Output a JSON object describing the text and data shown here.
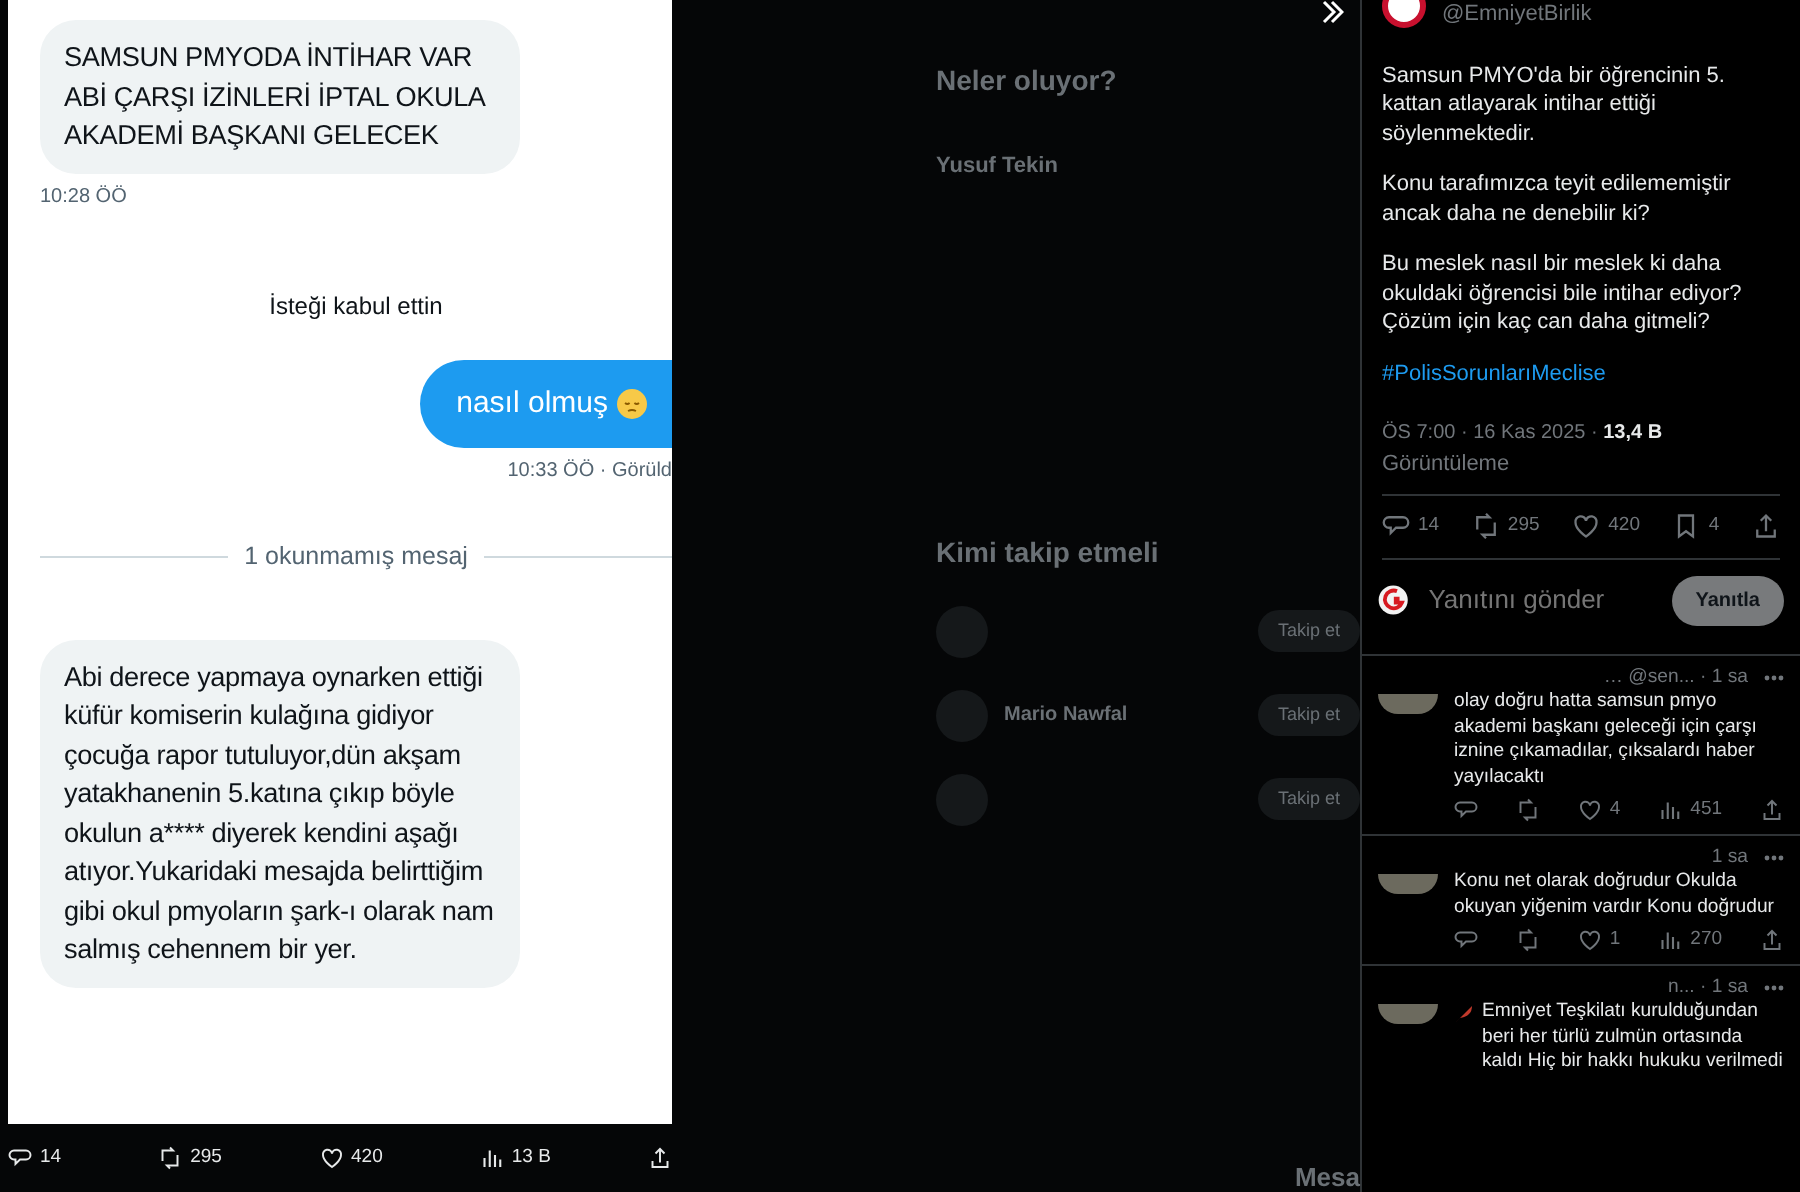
{
  "media": {
    "messages": [
      {
        "kind": "received",
        "text": "SAMSUN PMYODA İNTİHAR VAR ABİ ÇARŞI İZİNLERİ İPTAL OKULA AKADEMİ BAŞKANI GELECEK",
        "time": "10:28 ÖÖ"
      },
      {
        "kind": "notice",
        "text": "İsteği kabul ettin"
      },
      {
        "kind": "sent",
        "text": "nasıl olmuş",
        "time": "10:33 ÖÖ · Görüld"
      },
      {
        "kind": "divider",
        "text": "1 okunmamış mesaj"
      },
      {
        "kind": "received",
        "text": "Abi derece yapmaya oynarken ettiği küfür komiserin kulağına gidiyor çocuğa rapor tutuluyor,dün akşam yatakhanenin 5.katına çıkıp böyle okulun a**** diyerek kendini aşağı atıyor.Yukaridaki mesajda belirttiğim gibi okul pmyoların şark-ı olarak nam salmış cehennem bir yer."
      }
    ]
  },
  "media_actions": [
    {
      "kind": "reply",
      "count": "14"
    },
    {
      "kind": "repost",
      "count": "295"
    },
    {
      "kind": "like",
      "count": "420"
    },
    {
      "kind": "views",
      "count": "13 B"
    }
  ],
  "background": {
    "trends_title": "Neler oluyor?",
    "trends": [
      "Yusuf Tekin"
    ],
    "follow_title": "Kimi takip etmeli",
    "accounts": [
      {
        "button": "Takip et"
      },
      {
        "name": "Mario Nawfal",
        "button": "Takip et"
      },
      {
        "button": "Takip et"
      }
    ],
    "drawer": "Mesa"
  },
  "tweet": {
    "handle": "@EmniyetBirlik",
    "paragraphs": [
      "Samsun PMYO'da bir öğrencinin 5. kattan atlayarak intihar ettiği söylenmektedir.",
      "Konu tarafımızca teyit edilememiştir ancak daha ne denebilir ki?",
      "Bu meslek nasıl bir meslek ki daha okuldaki öğrencisi bile intihar ediyor? Çözüm için kaç can daha gitmeli?"
    ],
    "hashtag": "#PolisSorunlarıMeclise",
    "meta": "ÖS 7:00 · 16 Kas 2025 · **13,4 B**",
    "views_label": "Görüntüleme",
    "actions": [
      {
        "kind": "reply",
        "count": "14"
      },
      {
        "kind": "repost",
        "count": "295"
      },
      {
        "kind": "like",
        "count": "420"
      },
      {
        "kind": "bookmark",
        "count": "4"
      },
      {
        "kind": "share"
      }
    ]
  },
  "reply_box": {
    "placeholder": "Yanıtını gönder",
    "button": "Yanıtla",
    "disabled": true
  },
  "replies": [
    {
      "kind": "plain",
      "header": "… @sen... · 1 sa",
      "text": "olay doğru hatta samsun pmyo akademi başkanı geleceği için çarşı iznine çıkamadılar, çıksalardı haber yayılacaktı",
      "actions": [
        {
          "kind": "reply"
        },
        {
          "kind": "repost"
        },
        {
          "kind": "like",
          "count": "4"
        },
        {
          "kind": "views",
          "count": "451"
        },
        {
          "kind": "share"
        }
      ]
    },
    {
      "kind": "plain",
      "header": "1 sa",
      "text": "Konu net olarak doğrudur Okulda okuyan yiğenim vardır Konu doğrudur",
      "actions": [
        {
          "kind": "reply"
        },
        {
          "kind": "repost"
        },
        {
          "kind": "like",
          "count": "1"
        },
        {
          "kind": "views",
          "count": "270"
        },
        {
          "kind": "share"
        }
      ]
    },
    {
      "kind": "feather",
      "header": "n... · 1 sa",
      "text": "Emniyet Teşkilatı kurulduğundan beri her türlü zulmün ortasında kaldı Hiç bir hakkı hukuku verilmedi"
    }
  ]
}
